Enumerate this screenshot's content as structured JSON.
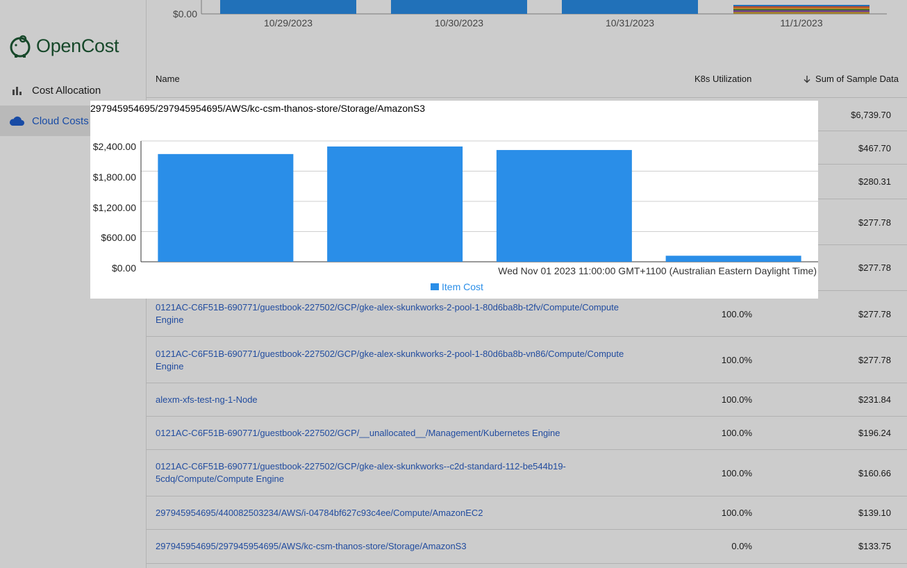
{
  "app": {
    "name": "OpenCost"
  },
  "sidebar": {
    "items": [
      {
        "label": "Cost Allocation",
        "icon": "bar-chart-icon",
        "active": false
      },
      {
        "label": "Cloud Costs",
        "icon": "cloud-icon",
        "active": true
      }
    ]
  },
  "top_chart": {
    "y_tick": "$0.00",
    "dates": [
      "10/29/2023",
      "10/30/2023",
      "10/31/2023",
      "11/1/2023"
    ],
    "bar_color": "#2a8ee8"
  },
  "table": {
    "headers": {
      "name": "Name",
      "utilization": "K8s Utilization",
      "cost": "Sum of Sample Data"
    },
    "sort_icon": "arrow-down-icon",
    "rows": [
      {
        "name": "",
        "util": "",
        "cost": "$6,739.70"
      },
      {
        "name": "",
        "util": "",
        "cost": "$467.70"
      },
      {
        "name": "",
        "util": "",
        "cost": "$280.31"
      },
      {
        "name": "",
        "util": "",
        "cost": "$277.78"
      },
      {
        "name": "",
        "util": "",
        "cost": "$277.78"
      },
      {
        "name": "0121AC-C6F51B-690771/guestbook-227502/GCP/gke-alex-skunkworks-2-pool-1-80d6ba8b-t2fv/Compute/Compute Engine",
        "util": "100.0%",
        "cost": "$277.78"
      },
      {
        "name": "0121AC-C6F51B-690771/guestbook-227502/GCP/gke-alex-skunkworks-2-pool-1-80d6ba8b-vn86/Compute/Compute Engine",
        "util": "100.0%",
        "cost": "$277.78"
      },
      {
        "name": "alexm-xfs-test-ng-1-Node",
        "util": "100.0%",
        "cost": "$231.84"
      },
      {
        "name": "0121AC-C6F51B-690771/guestbook-227502/GCP/__unallocated__/Management/Kubernetes Engine",
        "util": "100.0%",
        "cost": "$196.24"
      },
      {
        "name": "0121AC-C6F51B-690771/guestbook-227502/GCP/gke-alex-skunkworks--c2d-standard-112-be544b19-5cdq/Compute/Compute Engine",
        "util": "100.0%",
        "cost": "$160.66"
      },
      {
        "name": "297945954695/440082503234/AWS/i-04784bf627c93c4ee/Compute/AmazonEC2",
        "util": "100.0%",
        "cost": "$139.10"
      },
      {
        "name": "297945954695/297945954695/AWS/kc-csm-thanos-store/Storage/AmazonS3",
        "util": "0.0%",
        "cost": "$133.75"
      }
    ]
  },
  "modal": {
    "title": "297945954695/297945954695/AWS/kc-csm-thanos-store/Storage/AmazonS3",
    "xlabel": "Wed Nov 01 2023 11:00:00 GMT+1100 (Australian Eastern Daylight Time)",
    "legend": "Item Cost",
    "y_ticks": [
      "$2,400.00",
      "$1,800.00",
      "$1,200.00",
      "$600.00",
      "$0.00"
    ]
  },
  "chart_data": {
    "type": "bar",
    "title": "297945954695/297945954695/AWS/kc-csm-thanos-store/Storage/AmazonS3",
    "xlabel": "Wed Nov 01 2023 11:00:00 GMT+1100 (Australian Eastern Daylight Time)",
    "ylabel": "",
    "categories": [
      "",
      "",
      "",
      ""
    ],
    "series": [
      {
        "name": "Item Cost",
        "values": [
          2140,
          2290,
          2220,
          120
        ],
        "color": "#2a8ee8"
      }
    ],
    "ylim": [
      0,
      2400
    ],
    "grid": true,
    "legend": "bottom-center"
  }
}
